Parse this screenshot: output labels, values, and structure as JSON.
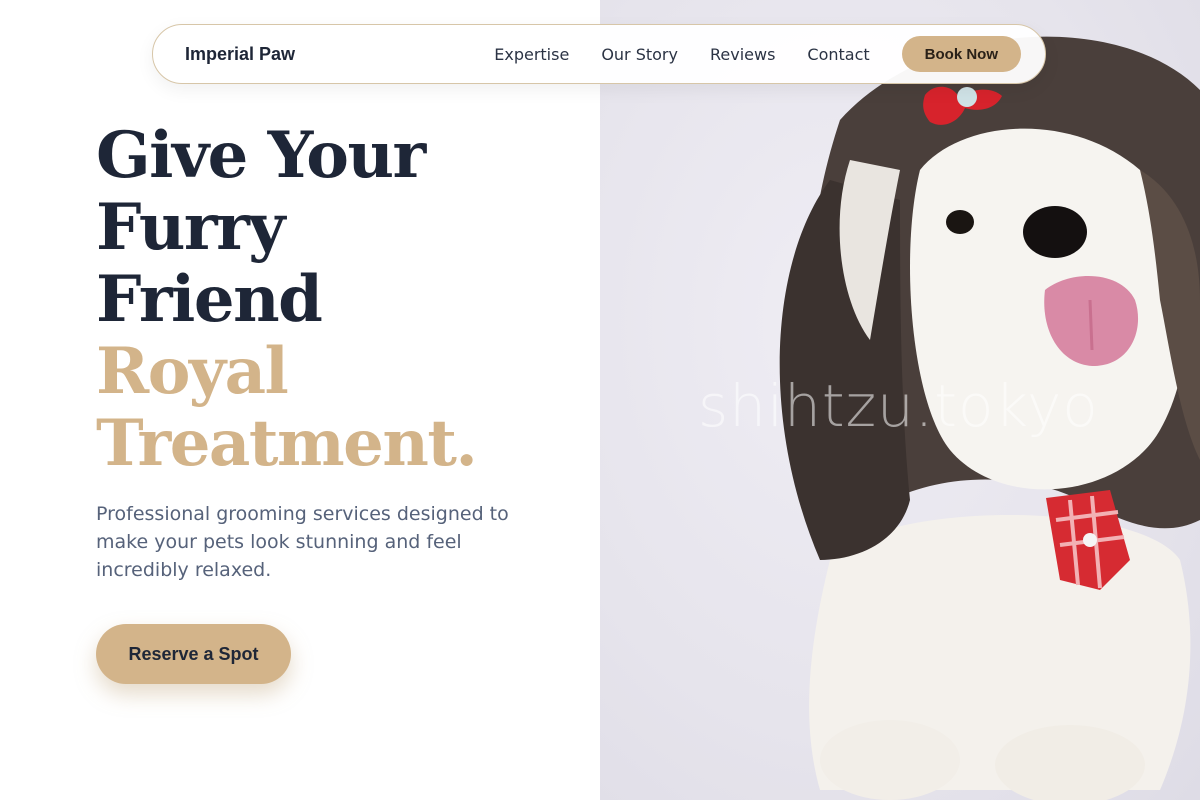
{
  "nav": {
    "brand": "Imperial Paw",
    "links": [
      "Expertise",
      "Our Story",
      "Reviews",
      "Contact"
    ],
    "cta_label": "Book Now"
  },
  "hero": {
    "title_lines": [
      "Give Your",
      "Furry",
      "Friend"
    ],
    "accent_lines": [
      "Royal",
      "Treatment."
    ],
    "subtitle": "Professional grooming services designed to make your pets look stunning and feel incredibly relaxed.",
    "cta_label": "Reserve a Spot"
  },
  "photo": {
    "watermark": "shihtzu.tokyo",
    "subject": "shih-tzu dog with red bow and tie"
  },
  "colors": {
    "accent": "#d3b48a",
    "navy": "#1e2637",
    "body_text": "#56627a"
  }
}
